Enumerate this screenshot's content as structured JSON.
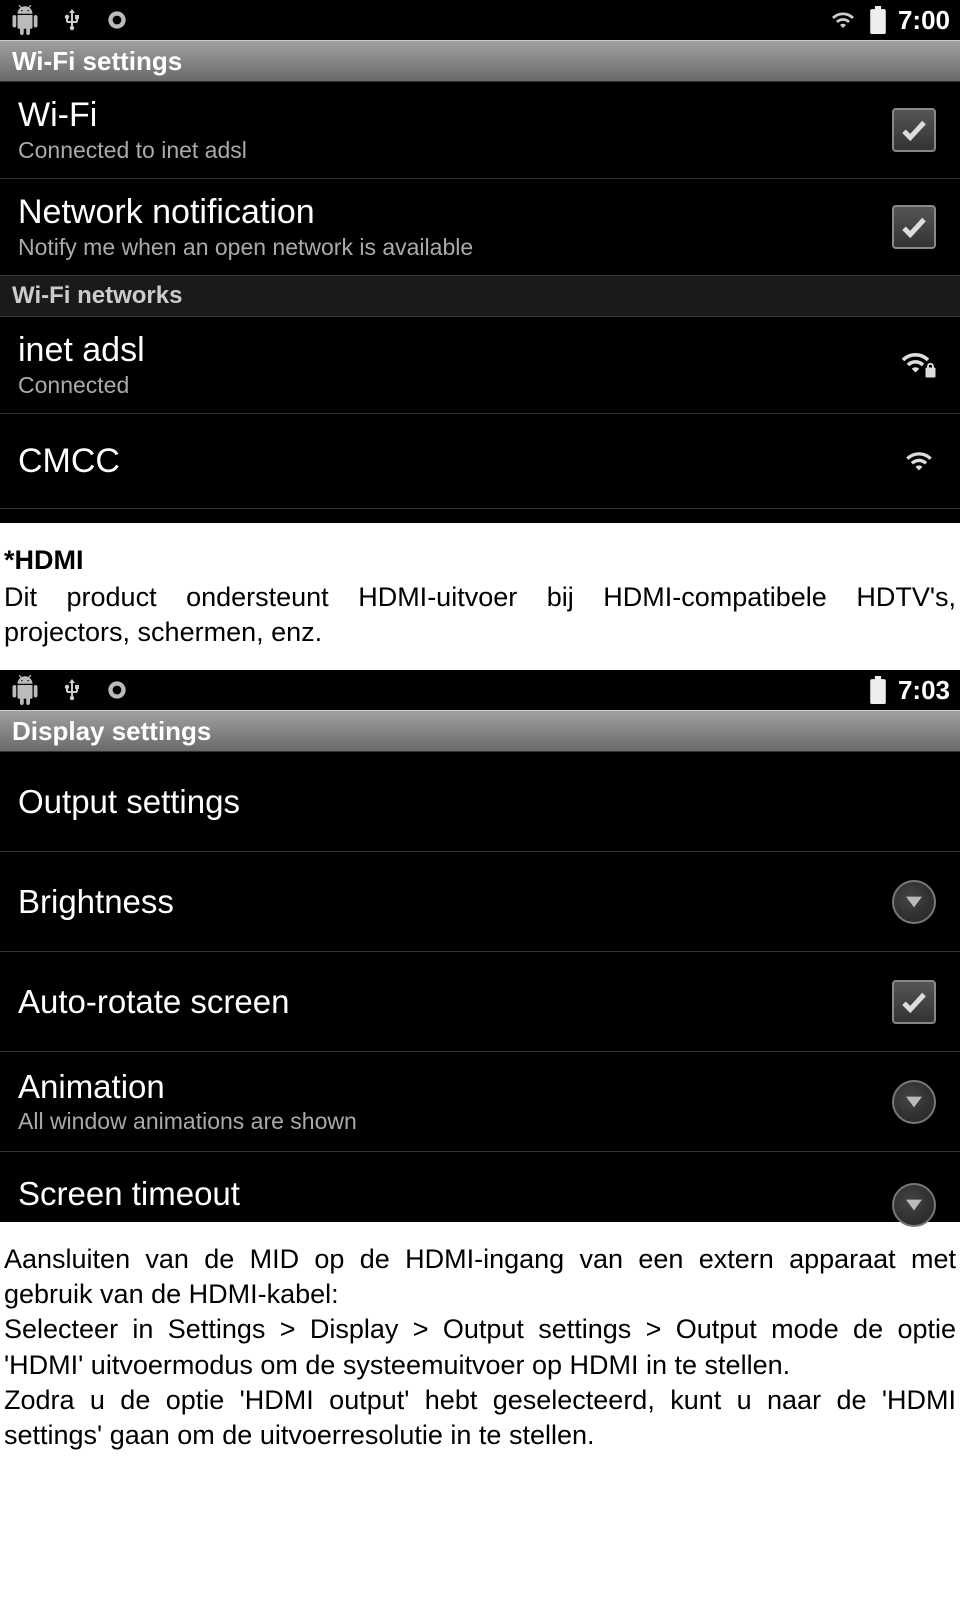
{
  "screen1": {
    "status": {
      "time": "7:00"
    },
    "header": "Wi-Fi settings",
    "items": [
      {
        "title": "Wi-Fi",
        "sub": "Connected to inet adsl"
      },
      {
        "title": "Network notification",
        "sub": "Notify me when an open network is available"
      }
    ],
    "section": "Wi-Fi networks",
    "networks": [
      {
        "title": "inet adsl",
        "sub": "Connected"
      },
      {
        "title": "CMCC",
        "sub": ""
      }
    ]
  },
  "doc1": {
    "heading": "*HDMI",
    "para": "Dit product ondersteunt HDMI-uitvoer bij HDMI-compatibele HDTV's, projectors, schermen, enz."
  },
  "screen2": {
    "status": {
      "time": "7:03"
    },
    "header": "Display settings",
    "items": [
      {
        "title": "Output settings",
        "sub": "",
        "control": "none"
      },
      {
        "title": "Brightness",
        "sub": "",
        "control": "circle"
      },
      {
        "title": "Auto-rotate screen",
        "sub": "",
        "control": "check"
      },
      {
        "title": "Animation",
        "sub": "All window animations are shown",
        "control": "circle"
      },
      {
        "title": "Screen timeout",
        "sub": "",
        "control": "circle"
      }
    ]
  },
  "doc2": {
    "p1": "Aansluiten van de MID op de HDMI-ingang van een extern apparaat met gebruik van de HDMI-kabel:",
    "p2": "Selecteer in Settings > Display > Output settings > Output mode de optie 'HDMI' uitvoermodus om de systeemuitvoer op HDMI in te stellen.",
    "p3": "Zodra u de optie 'HDMI output' hebt geselecteerd, kunt u naar de 'HDMI settings' gaan om de uitvoerresolutie in te stellen."
  }
}
